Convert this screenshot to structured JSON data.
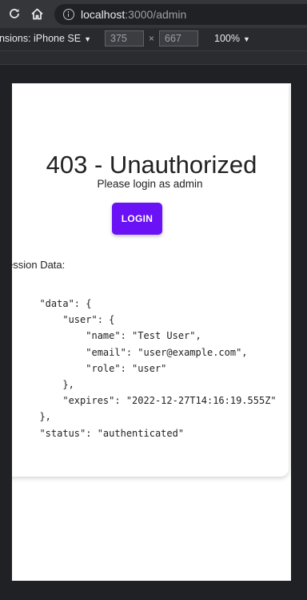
{
  "browser": {
    "url_host": "localhost",
    "url_path": ":3000/admin"
  },
  "device_toolbar": {
    "dimensions_label": "ensions: iPhone SE",
    "width": "375",
    "height": "667",
    "times": "×",
    "zoom": "100%"
  },
  "page": {
    "title": "403 - Unauthorized",
    "subtitle": "Please login as admin",
    "login_button": "LOGIN",
    "session_label": "ession Data:",
    "session_json": "  \"data\": {\n      \"user\": {\n          \"name\": \"Test User\",\n          \"email\": \"user@example.com\",\n          \"role\": \"user\"\n      },\n      \"expires\": \"2022-12-27T14:16:19.555Z\"\n  },\n  \"status\": \"authenticated\""
  },
  "colors": {
    "accent": "#6a11f6",
    "chrome_dark": "#202124"
  },
  "icons": [
    "reload-icon",
    "home-icon",
    "info-icon",
    "caret-down-icon"
  ]
}
